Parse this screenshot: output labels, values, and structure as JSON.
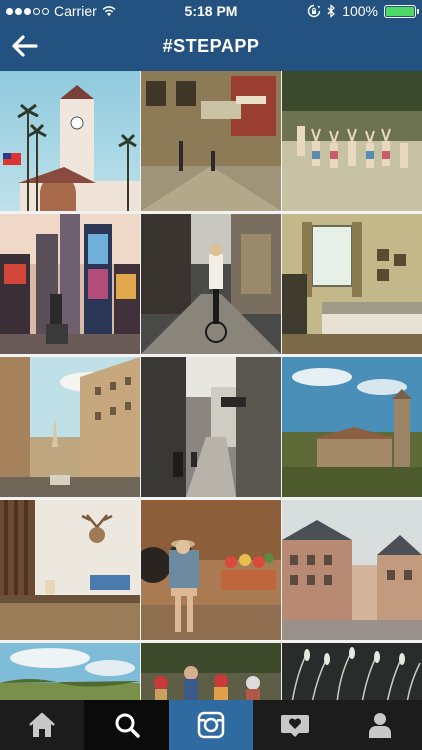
{
  "status_bar": {
    "carrier": "Carrier",
    "time": "5:18 PM",
    "battery": "100%",
    "signal_bars_filled": 3,
    "signal_bars_total": 5
  },
  "nav": {
    "title": "#STEPAPP",
    "back_icon": "arrow-left-icon"
  },
  "grid": {
    "photos": [
      {
        "name": "photo-union-station"
      },
      {
        "name": "photo-european-street"
      },
      {
        "name": "photo-children-cheering"
      },
      {
        "name": "photo-times-square"
      },
      {
        "name": "photo-cyclist-street"
      },
      {
        "name": "photo-bedroom-interior"
      },
      {
        "name": "photo-paris-boulevard"
      },
      {
        "name": "photo-alley-bw"
      },
      {
        "name": "photo-countryside-church"
      },
      {
        "name": "photo-cafe-deer-trophy"
      },
      {
        "name": "photo-woman-sitting"
      },
      {
        "name": "photo-town-square"
      },
      {
        "name": "photo-meadow-sky"
      },
      {
        "name": "photo-cyclists-group"
      },
      {
        "name": "photo-wild-grass"
      }
    ]
  },
  "tabbar": {
    "tabs": [
      {
        "icon": "home-icon"
      },
      {
        "icon": "search-icon"
      },
      {
        "icon": "camera-icon"
      },
      {
        "icon": "activity-heart-icon"
      },
      {
        "icon": "profile-icon"
      }
    ]
  },
  "colors": {
    "header_bg": "#245280",
    "tabbar_bg": "#1c1c1c",
    "camera_tab_bg": "#2f6ba1",
    "battery_fill": "#4cd964"
  }
}
